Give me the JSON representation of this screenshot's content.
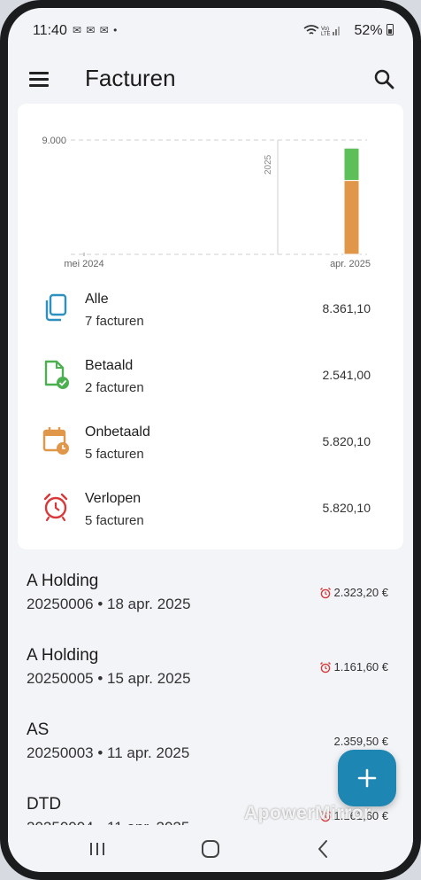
{
  "status_bar": {
    "time": "11:40",
    "notifications": "✉ ✉ ✉ •",
    "battery": "52%"
  },
  "app_bar": {
    "title": "Facturen"
  },
  "chart_data": {
    "type": "bar",
    "y_ticks": [
      "9.000"
    ],
    "x_ticks": [
      "mei 2024",
      "apr. 2025"
    ],
    "year_marker": "2025",
    "categories": [
      "apr. 2025"
    ],
    "series": [
      {
        "color": "#e0974a",
        "values": [
          5820.1
        ]
      },
      {
        "color": "#5cbf57",
        "values": [
          2541.0
        ]
      }
    ],
    "ylim": [
      0,
      9000
    ]
  },
  "summary": [
    {
      "label": "Alle",
      "sub": "7 facturen",
      "amount": "8.361,10",
      "icon": "copy-icon",
      "color": "#2e90bf"
    },
    {
      "label": "Betaald",
      "sub": "2 facturen",
      "amount": "2.541,00",
      "icon": "file-check-icon",
      "color": "#4caf50"
    },
    {
      "label": "Onbetaald",
      "sub": "5 facturen",
      "amount": "5.820,10",
      "icon": "calendar-clock-icon",
      "color": "#e0974a"
    },
    {
      "label": "Verlopen",
      "sub": "5 facturen",
      "amount": "5.820,10",
      "icon": "alarm-icon",
      "color": "#d9383a"
    }
  ],
  "invoices": [
    {
      "name": "A Holding",
      "meta": "20250006 • 18 apr. 2025",
      "amount": "2.323,20 €",
      "overdue": true
    },
    {
      "name": "A Holding",
      "meta": "20250005 • 15 apr. 2025",
      "amount": "1.161,60 €",
      "overdue": true
    },
    {
      "name": "AS",
      "meta": "20250003 • 11 apr. 2025",
      "amount": "2.359,50 €",
      "overdue": false
    },
    {
      "name": "DTD",
      "meta": "20250004 • 11 apr. 2025",
      "amount": "1.161,60 €",
      "overdue": true
    }
  ],
  "watermark": "ApowerMirror"
}
